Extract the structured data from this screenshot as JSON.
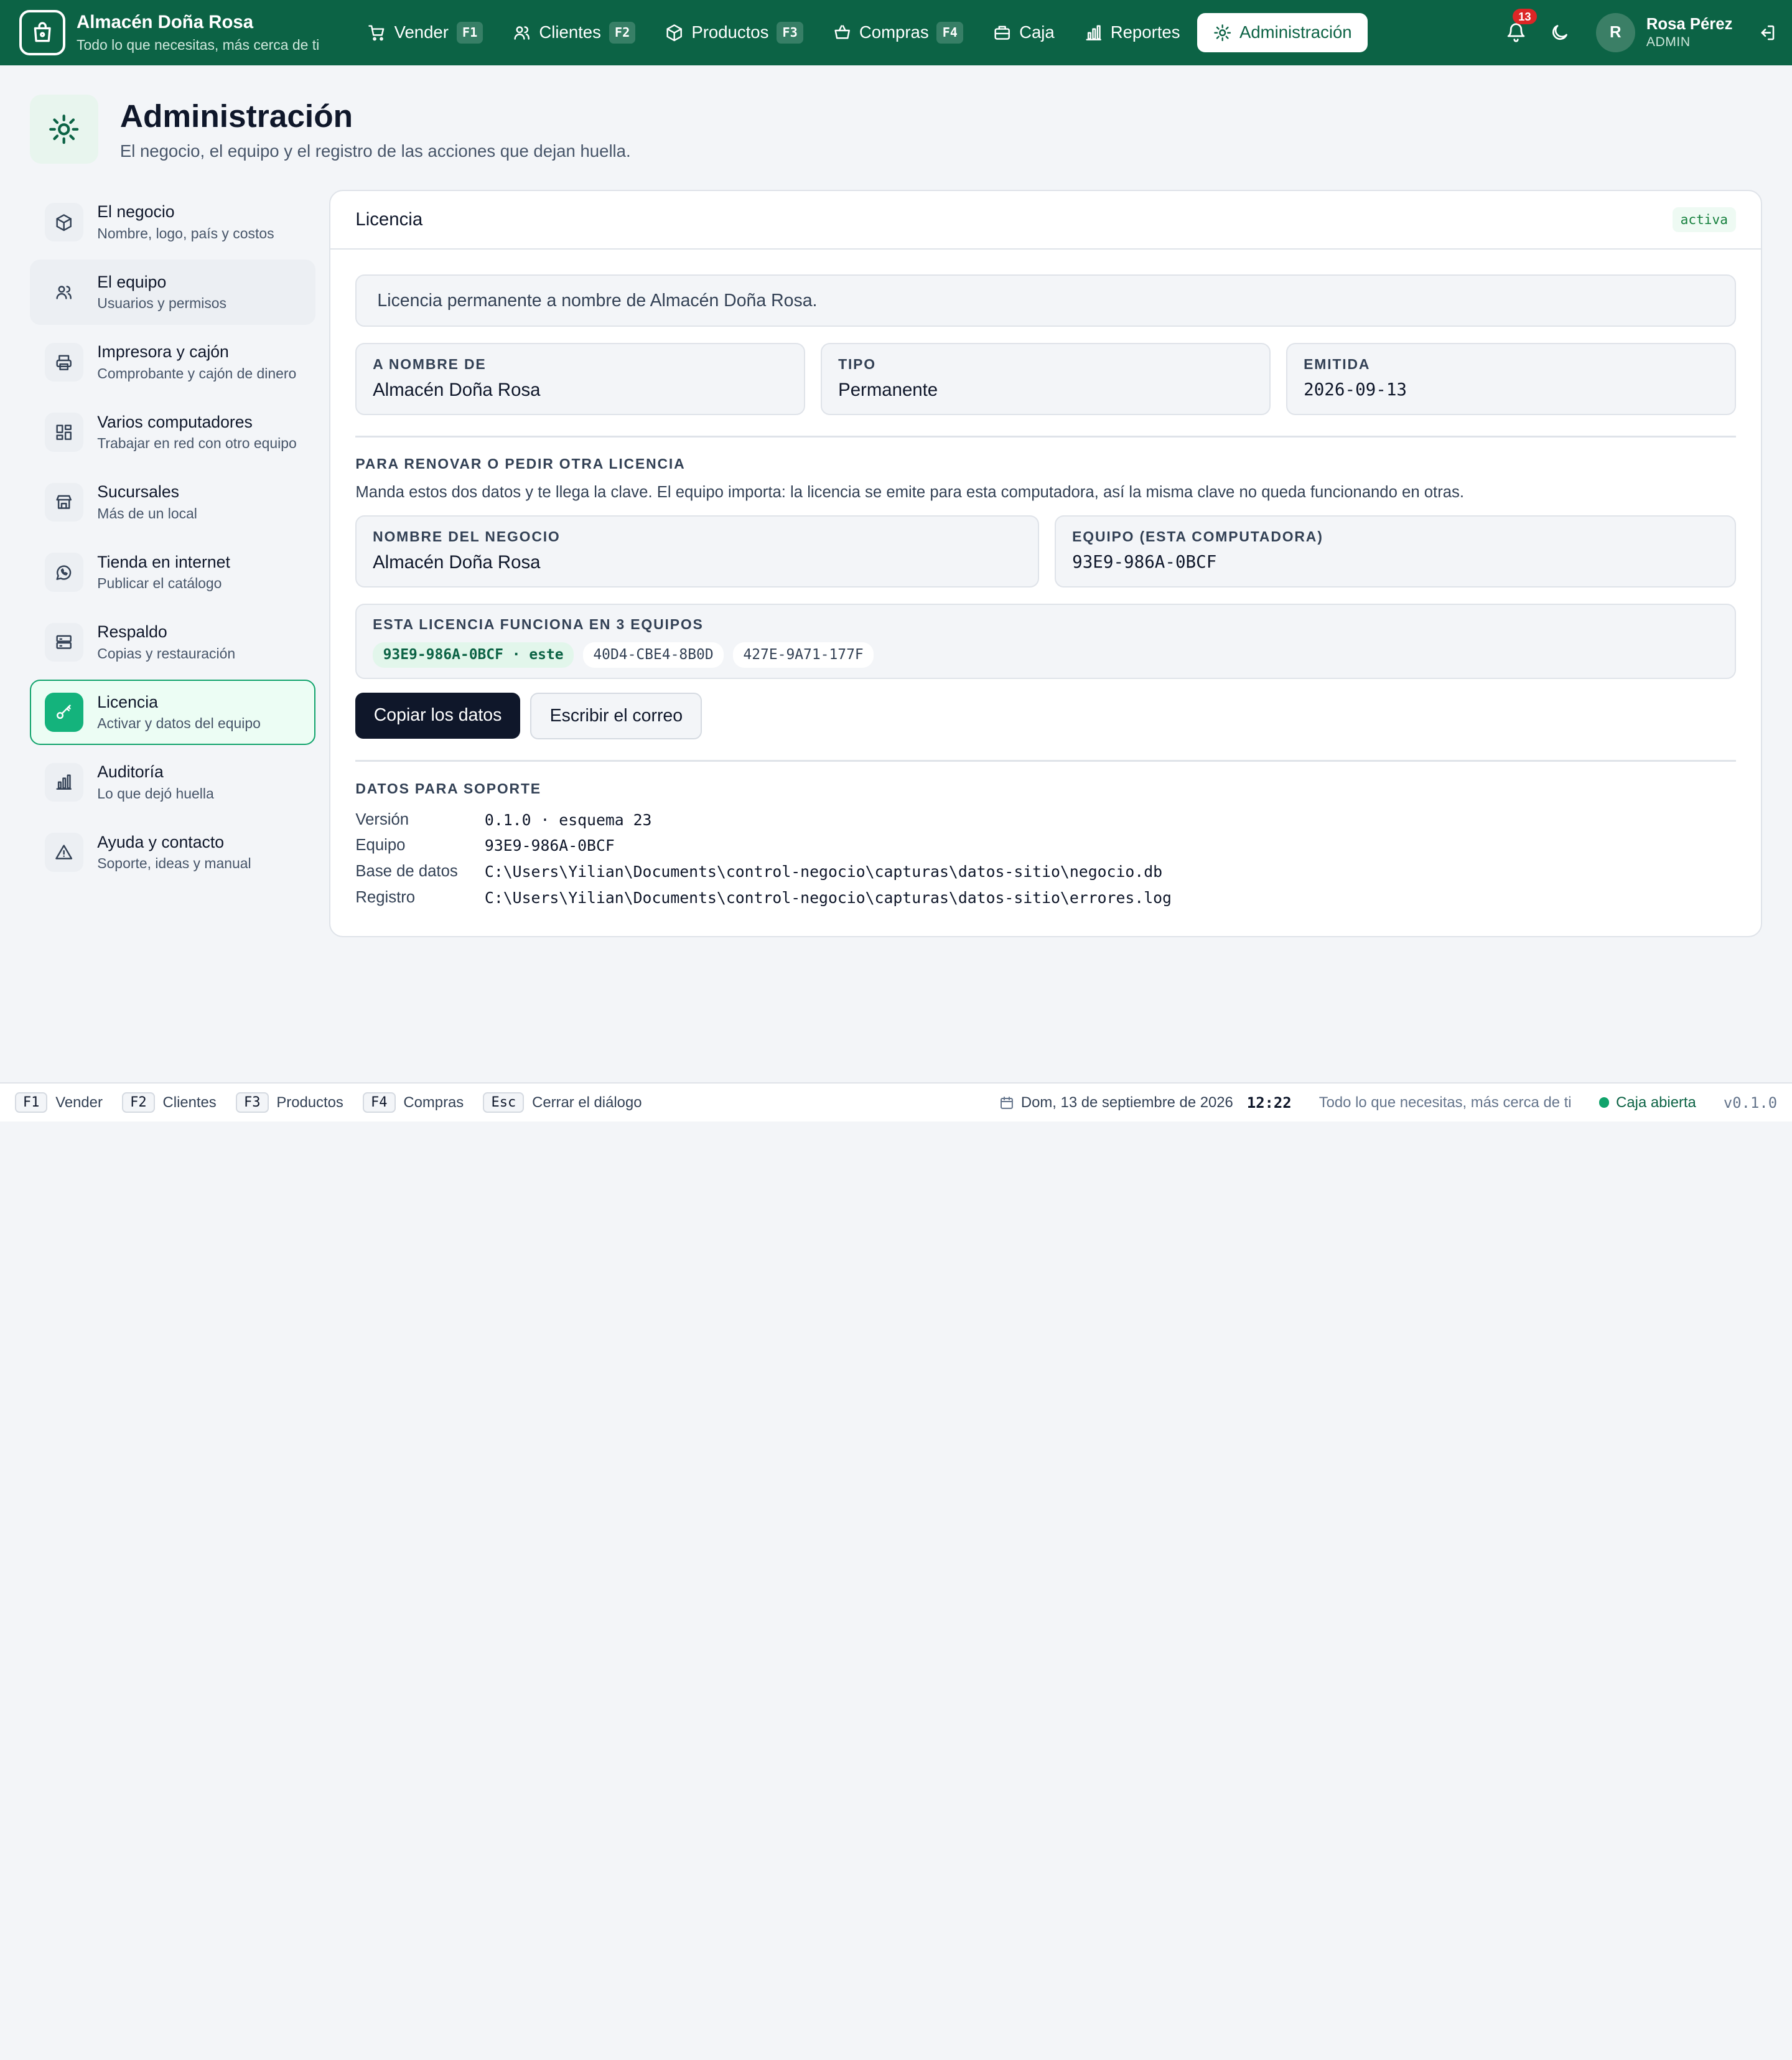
{
  "brand": {
    "name": "Almacén Doña Rosa",
    "tagline": "Todo lo que necesitas, más cerca de ti"
  },
  "nav": [
    {
      "label": "Vender",
      "key": "F1",
      "icon": "cart-icon"
    },
    {
      "label": "Clientes",
      "key": "F2",
      "icon": "users-icon"
    },
    {
      "label": "Productos",
      "key": "F3",
      "icon": "box-icon"
    },
    {
      "label": "Compras",
      "key": "F4",
      "icon": "basket-icon"
    },
    {
      "label": "Caja",
      "key": "",
      "icon": "register-icon"
    },
    {
      "label": "Reportes",
      "key": "",
      "icon": "chart-icon"
    },
    {
      "label": "Administración",
      "key": "",
      "icon": "sun-gear-icon",
      "active": true
    }
  ],
  "user": {
    "notifications": "13",
    "initial": "R",
    "name": "Rosa Pérez",
    "role": "ADMIN"
  },
  "header": {
    "title": "Administración",
    "subtitle": "El negocio, el equipo y el registro de las acciones que dejan huella."
  },
  "sidebar": [
    {
      "label": "El negocio",
      "desc": "Nombre, logo, país y costos"
    },
    {
      "label": "El equipo",
      "desc": "Usuarios y permisos"
    },
    {
      "label": "Impresora y cajón",
      "desc": "Comprobante y cajón de dinero"
    },
    {
      "label": "Varios computadores",
      "desc": "Trabajar en red con otro equipo"
    },
    {
      "label": "Sucursales",
      "desc": "Más de un local"
    },
    {
      "label": "Tienda en internet",
      "desc": "Publicar el catálogo"
    },
    {
      "label": "Respaldo",
      "desc": "Copias y restauración"
    },
    {
      "label": "Licencia",
      "desc": "Activar y datos del equipo"
    },
    {
      "label": "Auditoría",
      "desc": "Lo que dejó huella"
    },
    {
      "label": "Ayuda y contacto",
      "desc": "Soporte, ideas y manual"
    }
  ],
  "panel": {
    "title": "Licencia",
    "status": "activa",
    "notice": "Licencia permanente a nombre de Almacén Doña Rosa.",
    "fields": [
      {
        "label": "A NOMBRE DE",
        "value": "Almacén Doña Rosa"
      },
      {
        "label": "TIPO",
        "value": "Permanente"
      },
      {
        "label": "EMITIDA",
        "value": "2026-09-13"
      }
    ],
    "renew": {
      "title": "PARA RENOVAR O PEDIR OTRA LICENCIA",
      "text": "Manda estos dos datos y te llega la clave. El equipo importa: la licencia se emite para esta computadora, así la misma clave no queda funcionando en otras.",
      "business_label": "NOMBRE DEL NEGOCIO",
      "business_value": "Almacén Doña Rosa",
      "device_label": "EQUIPO (ESTA COMPUTADORA)",
      "device_value": "93E9-986A-0BCF"
    },
    "devices": {
      "label": "ESTA LICENCIA FUNCIONA EN 3 EQUIPOS",
      "list": [
        "93E9-986A-0BCF · este",
        "40D4-CBE4-8B0D",
        "427E-9A71-177F"
      ]
    },
    "buttons": {
      "copy": "Copiar los datos",
      "email": "Escribir el correo"
    },
    "support": {
      "title": "DATOS PARA SOPORTE",
      "rows": [
        {
          "label": "Versión",
          "value": "0.1.0 · esquema 23"
        },
        {
          "label": "Equipo",
          "value": "93E9-986A-0BCF"
        },
        {
          "label": "Base de datos",
          "value": "C:\\Users\\Yilian\\Documents\\control-negocio\\capturas\\datos-sitio\\negocio.db"
        },
        {
          "label": "Registro",
          "value": "C:\\Users\\Yilian\\Documents\\control-negocio\\capturas\\datos-sitio\\errores.log"
        }
      ]
    }
  },
  "footer": {
    "shortcuts": [
      {
        "key": "F1",
        "label": "Vender"
      },
      {
        "key": "F2",
        "label": "Clientes"
      },
      {
        "key": "F3",
        "label": "Productos"
      },
      {
        "key": "F4",
        "label": "Compras"
      },
      {
        "key": "Esc",
        "label": "Cerrar el diálogo"
      }
    ],
    "date": "Dom, 13 de septiembre de 2026",
    "time": "12:22",
    "tagline": "Todo lo que necesitas, más cerca de ti",
    "register_status": "Caja abierta",
    "version": "v0.1.0"
  },
  "colors": {
    "primary": "#0c6345",
    "accent": "#14b37c",
    "badge": "#dc2626"
  }
}
